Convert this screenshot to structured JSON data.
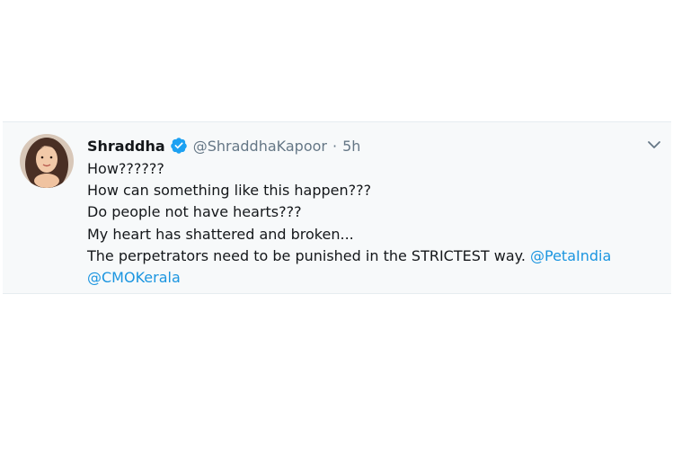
{
  "tweet": {
    "display_name": "Shraddha",
    "handle": "@ShraddhaKapoor",
    "separator": "·",
    "time": "5h",
    "lines": [
      "How??????",
      "How can something like this happen???",
      "Do people not have hearts???",
      "My heart has shattered and broken...",
      "The perpetrators need to be punished in the STRICTEST way. "
    ],
    "mention_1": "@PetaIndia",
    "mention_2": "@CMOKerala",
    "verified_icon": "verified-check-icon",
    "menu_icon": "chevron-down-icon"
  },
  "colors": {
    "card_bg": "#f7f9fa",
    "text": "#14171a",
    "muted": "#657786",
    "link": "#1b95e0",
    "verified": "#1da1f2"
  }
}
